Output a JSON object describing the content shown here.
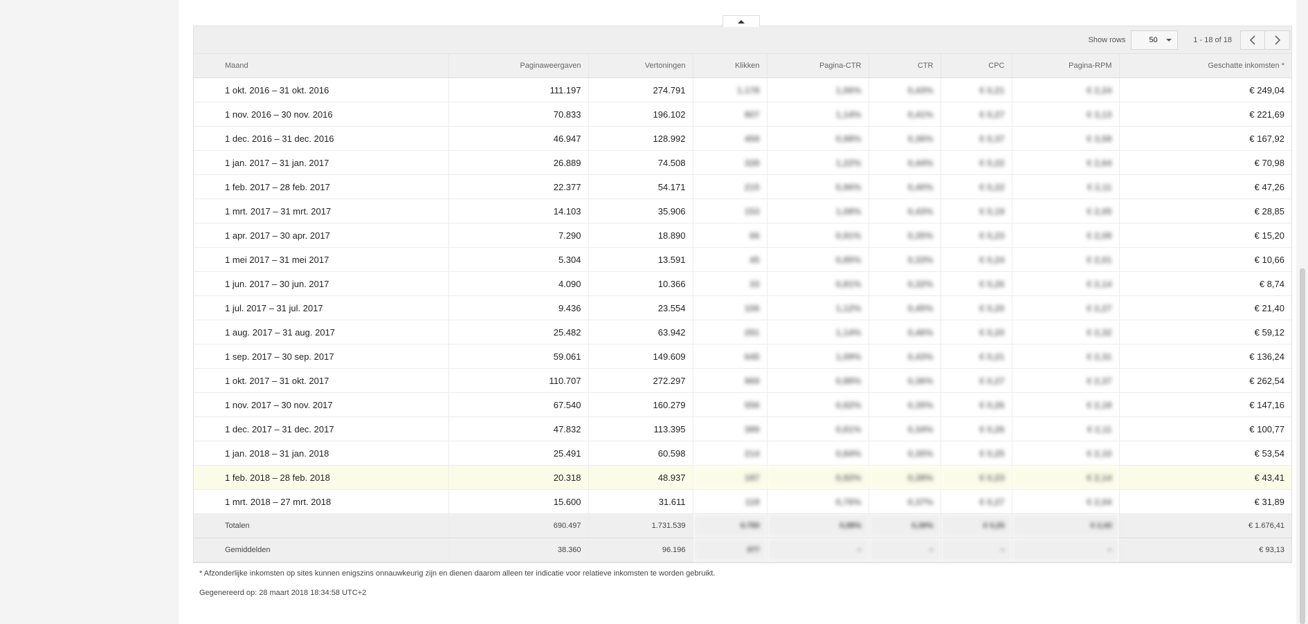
{
  "toolbar": {
    "show_rows_label": "Show rows",
    "rows_value": "50",
    "range_text": "1 - 18 of 18"
  },
  "columns": [
    "Maand",
    "Paginaweergaven",
    "Vertoningen",
    "Klikken",
    "Pagina-CTR",
    "CTR",
    "CPC",
    "Pagina-RPM",
    "Geschatte inkomsten *"
  ],
  "rows": [
    {
      "maand": "1 okt. 2016 – 31 okt. 2016",
      "pv": "111.197",
      "vert": "274.791",
      "klik": "1.178",
      "pctr": "1,06%",
      "ctr": "0,43%",
      "cpc": "€ 0,21",
      "rpm": "€ 2,24",
      "ink": "€ 249,04"
    },
    {
      "maand": "1 nov. 2016 – 30 nov. 2016",
      "pv": "70.833",
      "vert": "196.102",
      "klik": "807",
      "pctr": "1,14%",
      "ctr": "0,41%",
      "cpc": "€ 0,27",
      "rpm": "€ 3,13",
      "ink": "€ 221,69"
    },
    {
      "maand": "1 dec. 2016 – 31 dec. 2016",
      "pv": "46.947",
      "vert": "128.992",
      "klik": "459",
      "pctr": "0,98%",
      "ctr": "0,36%",
      "cpc": "€ 0,37",
      "rpm": "€ 3,58",
      "ink": "€ 167,92"
    },
    {
      "maand": "1 jan. 2017 – 31 jan. 2017",
      "pv": "26.889",
      "vert": "74.508",
      "klik": "328",
      "pctr": "1,22%",
      "ctr": "0,44%",
      "cpc": "€ 0,22",
      "rpm": "€ 2,64",
      "ink": "€ 70,98"
    },
    {
      "maand": "1 feb. 2017 – 28 feb. 2017",
      "pv": "22.377",
      "vert": "54.171",
      "klik": "215",
      "pctr": "0,96%",
      "ctr": "0,40%",
      "cpc": "€ 0,22",
      "rpm": "€ 2,11",
      "ink": "€ 47,26"
    },
    {
      "maand": "1 mrt. 2017 – 31 mrt. 2017",
      "pv": "14.103",
      "vert": "35.906",
      "klik": "153",
      "pctr": "1,08%",
      "ctr": "0,43%",
      "cpc": "€ 0,19",
      "rpm": "€ 2,05",
      "ink": "€ 28,85"
    },
    {
      "maand": "1 apr. 2017 – 30 apr. 2017",
      "pv": "7.290",
      "vert": "18.890",
      "klik": "66",
      "pctr": "0,91%",
      "ctr": "0,35%",
      "cpc": "€ 0,23",
      "rpm": "€ 2,08",
      "ink": "€ 15,20"
    },
    {
      "maand": "1 mei 2017 – 31 mei 2017",
      "pv": "5.304",
      "vert": "13.591",
      "klik": "45",
      "pctr": "0,85%",
      "ctr": "0,33%",
      "cpc": "€ 0,24",
      "rpm": "€ 2,01",
      "ink": "€ 10,66"
    },
    {
      "maand": "1 jun. 2017 – 30 jun. 2017",
      "pv": "4.090",
      "vert": "10.366",
      "klik": "33",
      "pctr": "0,81%",
      "ctr": "0,32%",
      "cpc": "€ 0,26",
      "rpm": "€ 2,14",
      "ink": "€ 8,74"
    },
    {
      "maand": "1 jul. 2017 – 31 jul. 2017",
      "pv": "9.436",
      "vert": "23.554",
      "klik": "106",
      "pctr": "1,12%",
      "ctr": "0,45%",
      "cpc": "€ 0,20",
      "rpm": "€ 2,27",
      "ink": "€ 21,40"
    },
    {
      "maand": "1 aug. 2017 – 31 aug. 2017",
      "pv": "25.482",
      "vert": "63.942",
      "klik": "291",
      "pctr": "1,14%",
      "ctr": "0,46%",
      "cpc": "€ 0,20",
      "rpm": "€ 2,32",
      "ink": "€ 59,12"
    },
    {
      "maand": "1 sep. 2017 – 30 sep. 2017",
      "pv": "59.061",
      "vert": "149.609",
      "klik": "645",
      "pctr": "1,09%",
      "ctr": "0,43%",
      "cpc": "€ 0,21",
      "rpm": "€ 2,31",
      "ink": "€ 136,24"
    },
    {
      "maand": "1 okt. 2017 – 31 okt. 2017",
      "pv": "110.707",
      "vert": "272.297",
      "klik": "969",
      "pctr": "0,88%",
      "ctr": "0,36%",
      "cpc": "€ 0,27",
      "rpm": "€ 2,37",
      "ink": "€ 262,54"
    },
    {
      "maand": "1 nov. 2017 – 30 nov. 2017",
      "pv": "67.540",
      "vert": "160.279",
      "klik": "556",
      "pctr": "0,82%",
      "ctr": "0,35%",
      "cpc": "€ 0,26",
      "rpm": "€ 2,18",
      "ink": "€ 147,16"
    },
    {
      "maand": "1 dec. 2017 – 31 dec. 2017",
      "pv": "47.832",
      "vert": "113.395",
      "klik": "389",
      "pctr": "0,81%",
      "ctr": "0,34%",
      "cpc": "€ 0,26",
      "rpm": "€ 2,11",
      "ink": "€ 100,77"
    },
    {
      "maand": "1 jan. 2018 – 31 jan. 2018",
      "pv": "25.491",
      "vert": "60.598",
      "klik": "214",
      "pctr": "0,84%",
      "ctr": "0,35%",
      "cpc": "€ 0,25",
      "rpm": "€ 2,10",
      "ink": "€ 53,54"
    },
    {
      "maand": "1 feb. 2018 – 28 feb. 2018",
      "pv": "20.318",
      "vert": "48.937",
      "klik": "187",
      "pctr": "0,92%",
      "ctr": "0,38%",
      "cpc": "€ 0,23",
      "rpm": "€ 2,14",
      "ink": "€ 43,41",
      "highlight": true
    },
    {
      "maand": "1 mrt. 2018 – 27 mrt. 2018",
      "pv": "15.600",
      "vert": "31.611",
      "klik": "118",
      "pctr": "0,76%",
      "ctr": "0,37%",
      "cpc": "€ 0,27",
      "rpm": "€ 2,04",
      "ink": "€ 31,89"
    }
  ],
  "totals": {
    "maand": "Totalen",
    "pv": "690.497",
    "vert": "1.731.539",
    "klik": "6.750",
    "pctr": "0,98%",
    "ctr": "0,39%",
    "cpc": "€ 0,25",
    "rpm": "€ 2,43",
    "ink": "€ 1.676,41"
  },
  "averages": {
    "maand": "Gemiddelden",
    "pv": "38.360",
    "vert": "96.196",
    "klik": "377",
    "pctr": "–",
    "ctr": "–",
    "cpc": "–",
    "rpm": "–",
    "ink": "€ 93,13"
  },
  "footnote": "* Afzonderlijke inkomsten op sites kunnen enigszins onnauwkeurig zijn en dienen daarom alleen ter indicatie voor relatieve inkomsten te worden gebruikt.",
  "generated": "Gegenereerd op: 28 maart 2018 18:34:58 UTC+2"
}
